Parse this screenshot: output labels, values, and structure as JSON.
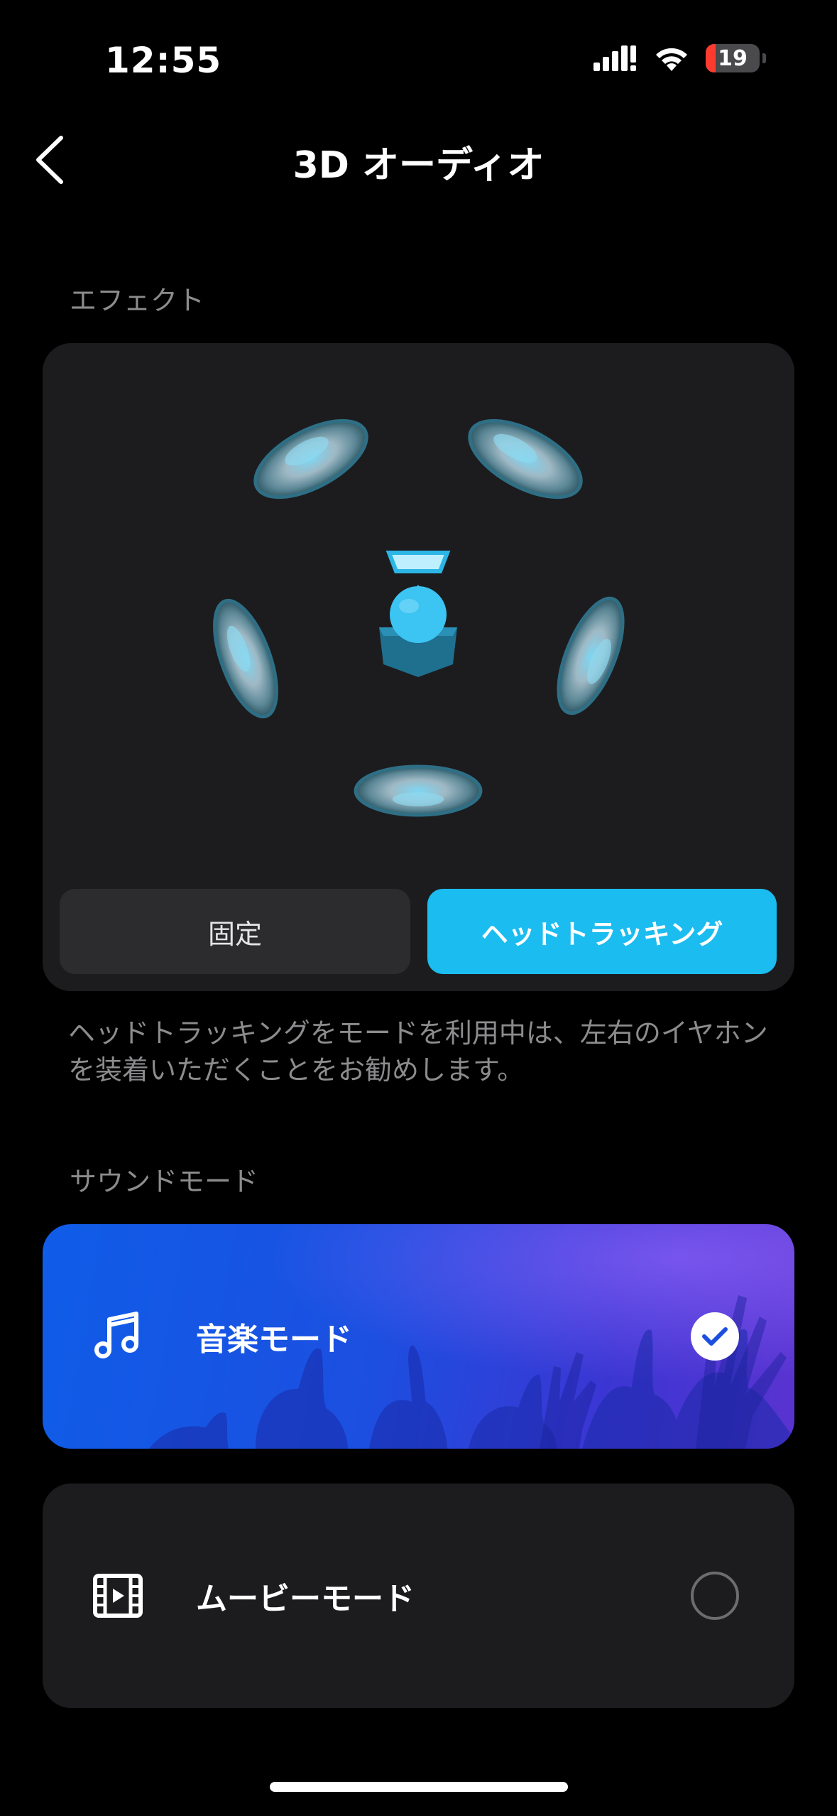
{
  "status_bar": {
    "time": "12:55",
    "battery_level": "19"
  },
  "nav": {
    "title": "3D オーディオ",
    "back_icon": "chevron-left-icon"
  },
  "effect": {
    "section_label": "エフェクト",
    "fixed_label": "固定",
    "head_tracking_label": "ヘッドトラッキング",
    "selected": "head_tracking",
    "note": "ヘッドトラッキングをモードを利用中は、左右のイヤホンを装着いただくことをお勧めします。"
  },
  "sound_mode": {
    "section_label": "サウンドモード",
    "modes": [
      {
        "label": "音楽モード",
        "icon": "music-note-icon",
        "selected": true
      },
      {
        "label": "ムービーモード",
        "icon": "film-icon",
        "selected": false
      }
    ]
  },
  "colors": {
    "accent": "#1bbcf0",
    "card": "#1c1c1e",
    "music_card": "#1c4fe0",
    "battery_low": "#ff3b30"
  }
}
